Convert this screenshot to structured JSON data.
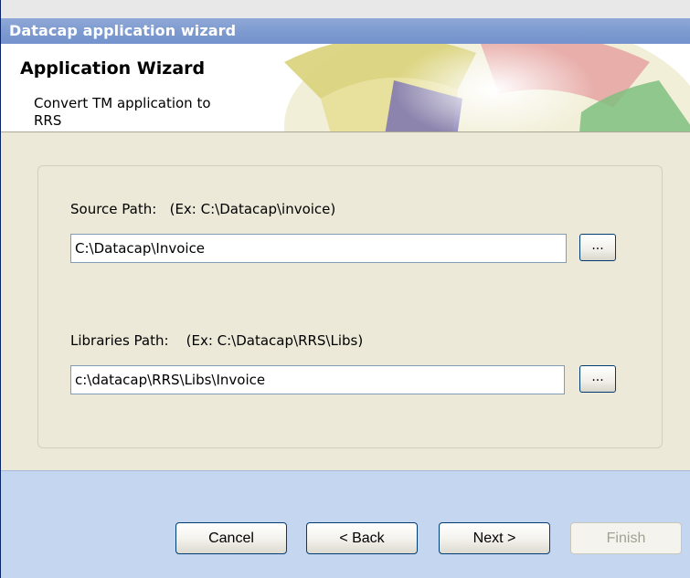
{
  "window": {
    "title": "Datacap application wizard"
  },
  "header": {
    "title": "Application Wizard",
    "subtitle": "Convert TM application to RRS"
  },
  "form": {
    "source": {
      "label": "Source Path:   (Ex: C:\\Datacap\\invoice)",
      "value": "C:\\Datacap\\Invoice",
      "browse_label": "..."
    },
    "libraries": {
      "label": "Libraries Path:    (Ex: C:\\Datacap\\RRS\\Libs)",
      "value": "c:\\datacap\\RRS\\Libs\\Invoice",
      "browse_label": "..."
    }
  },
  "footer": {
    "cancel_label": "Cancel",
    "back_label": "< Back",
    "next_label": "Next >",
    "finish_label": "Finish"
  },
  "colors": {
    "titlebar": "#7e9bd0",
    "footer": "#c5d6f0",
    "panel": "#ece9d8"
  }
}
